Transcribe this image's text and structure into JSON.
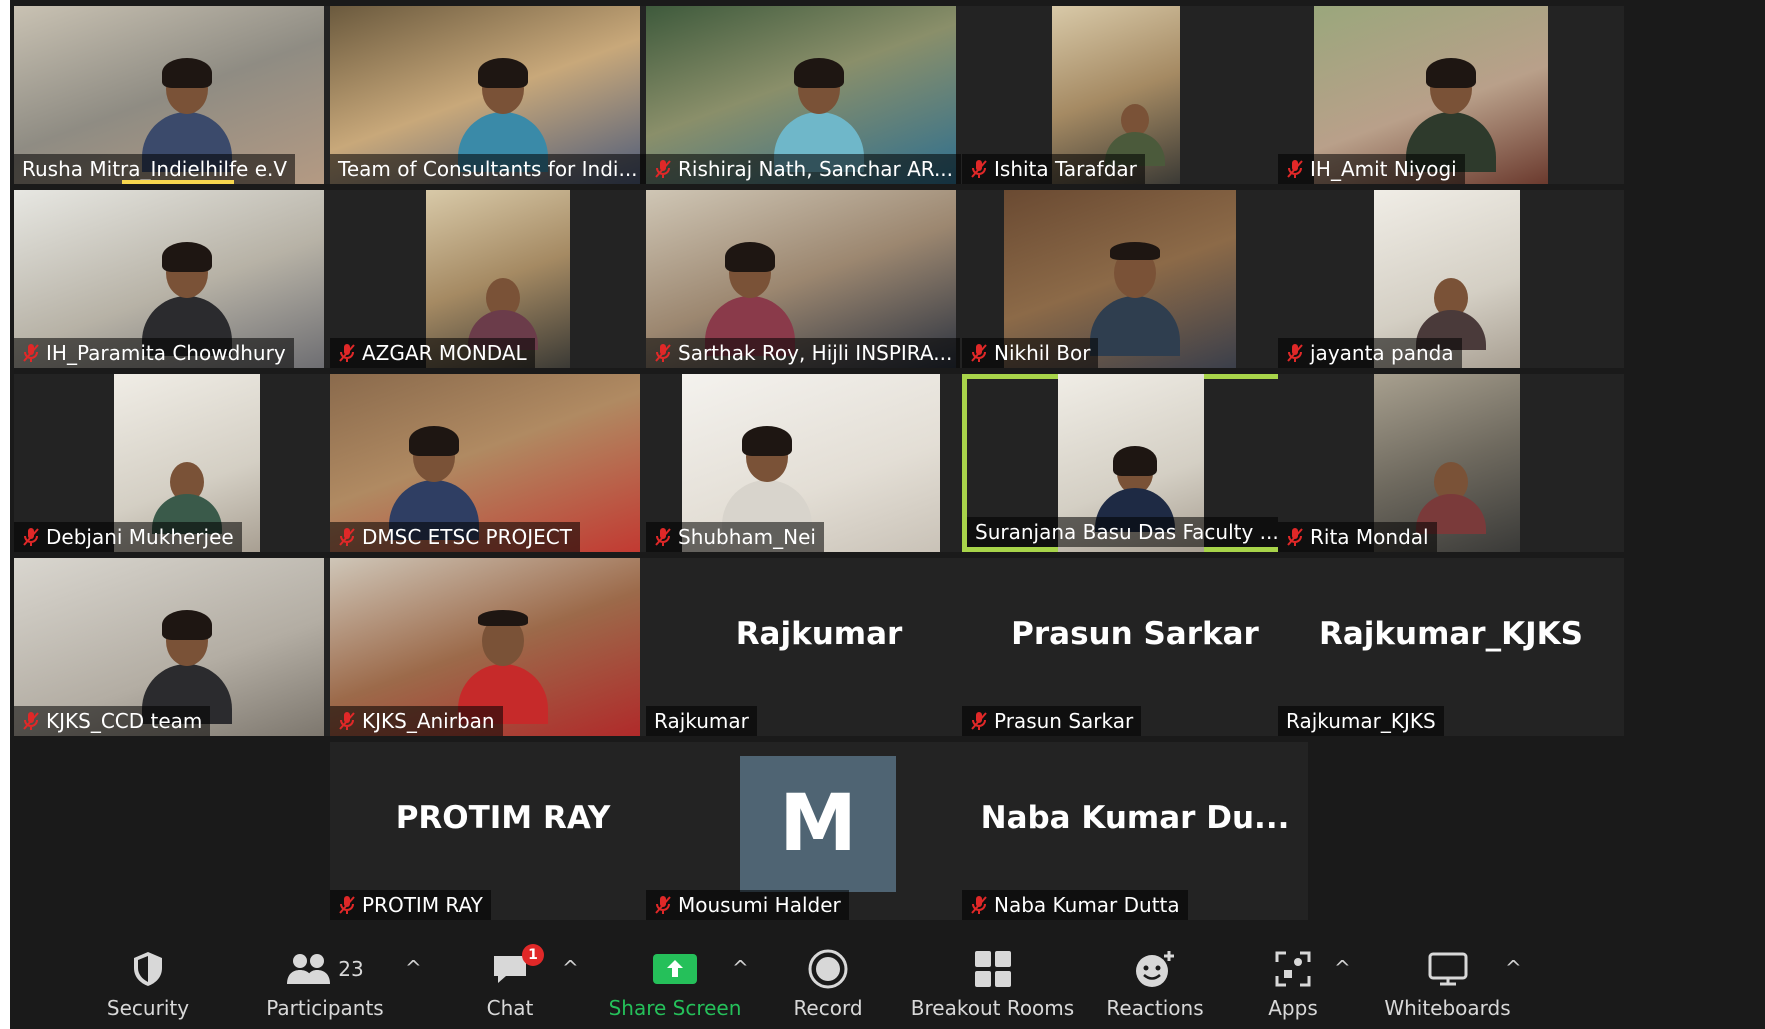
{
  "participants": [
    {
      "name": "Rusha Mitra_Indielhilfe e.V",
      "muted": false
    },
    {
      "name": "Team of Consultants for Indi...",
      "muted": false
    },
    {
      "name": "Rishiraj Nath, Sanchar AR...",
      "muted": true
    },
    {
      "name": "Ishita Tarafdar",
      "muted": true
    },
    {
      "name": "IH_Amit Niyogi",
      "muted": true
    },
    {
      "name": "IH_Paramita Chowdhury",
      "muted": true
    },
    {
      "name": "AZGAR MONDAL",
      "muted": true
    },
    {
      "name": "Sarthak Roy, Hijli INSPIRA...",
      "muted": true
    },
    {
      "name": "Nikhil Bor",
      "muted": true
    },
    {
      "name": "jayanta panda",
      "muted": true
    },
    {
      "name": "Debjani Mukherjee",
      "muted": true
    },
    {
      "name": "DMSC ETSC PROJECT",
      "muted": true
    },
    {
      "name": "Shubham_Nei",
      "muted": true
    },
    {
      "name": "Suranjana Basu Das Faculty ...",
      "muted": false
    },
    {
      "name": "Rita Mondal",
      "muted": true
    },
    {
      "name": "KJKS_CCD team",
      "muted": true
    },
    {
      "name": "KJKS_Anirban",
      "muted": true
    },
    {
      "name": "Rajkumar",
      "muted": false,
      "display": "Rajkumar"
    },
    {
      "name": "Prasun Sarkar",
      "muted": true,
      "display": "Prasun Sarkar"
    },
    {
      "name": "Rajkumar_KJKS",
      "muted": false,
      "display": "Rajkumar_KJKS"
    },
    {
      "name": "PROTIM RAY",
      "muted": true,
      "display": "PROTIM RAY"
    },
    {
      "name": "Mousumi Halder",
      "muted": true,
      "avatar_letter": "M"
    },
    {
      "name": "Naba Kumar Dutta",
      "muted": true,
      "display": "Naba Kumar Du..."
    }
  ],
  "toolbar": {
    "security": "Security",
    "participants": "Participants",
    "participants_count": "23",
    "chat": "Chat",
    "chat_badge": "1",
    "share_screen": "Share Screen",
    "record": "Record",
    "breakout_rooms": "Breakout Rooms",
    "reactions": "Reactions",
    "apps": "Apps",
    "whiteboards": "Whiteboards",
    "caret": "^"
  },
  "colors": {
    "background": "#1a1a1a",
    "tile": "#232323",
    "active_speaker_border": "#a8d44a",
    "share_green": "#25c05a",
    "mute_red": "#e02828",
    "badge_red": "#e02828",
    "avatar_bg": "#4f6473"
  },
  "icons": {
    "security": "shield-icon",
    "participants": "people-icon",
    "chat": "chat-bubble-icon",
    "share_screen": "share-up-arrow-icon",
    "record": "record-circle-icon",
    "breakout_rooms": "grid-icon",
    "reactions": "smiley-plus-icon",
    "apps": "apps-icon",
    "whiteboards": "whiteboard-icon",
    "mute": "mic-muted-icon"
  }
}
